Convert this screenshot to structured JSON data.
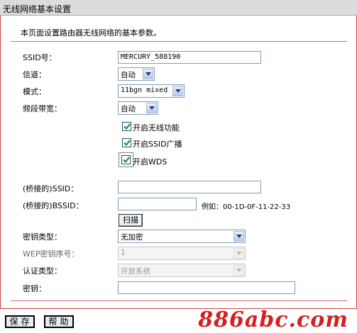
{
  "header": {
    "title": "无线网络基本设置"
  },
  "description": "本页面设置路由器无线网络的基本参数。",
  "form": {
    "ssid": {
      "label": "SSID号：",
      "value": "MERCURY_588190"
    },
    "channel": {
      "label": "信道：",
      "value": "自动"
    },
    "mode": {
      "label": "模式：",
      "value": "11bgn mixed"
    },
    "bandwidth": {
      "label": "频段带宽：",
      "value": "自动"
    },
    "enable_wireless": {
      "label": "开启无线功能",
      "checked": true
    },
    "enable_ssid_broadcast": {
      "label": "开启SSID广播",
      "checked": true
    },
    "enable_wds": {
      "label": "开启WDS",
      "checked": true
    },
    "bridge_ssid": {
      "label": "(桥接的)SSID：",
      "value": ""
    },
    "bridge_bssid": {
      "label": "(桥接的)BSSID：",
      "value": "",
      "example": "例如：00-1D-0F-11-22-33"
    },
    "scan_button": "扫描",
    "key_type": {
      "label": "密钥类型：",
      "value": "无加密"
    },
    "wep_index": {
      "label": "WEP密钥序号：",
      "value": "1"
    },
    "auth_type": {
      "label": "认证类型：",
      "value": "开放系统"
    },
    "key": {
      "label": "密钥：",
      "value": ""
    }
  },
  "footer": {
    "save_label": "保存",
    "help_label": "帮助"
  },
  "watermark": "886abc.com",
  "colors": {
    "accent_red": "#d42020",
    "checkbox_green": "#1a8a1a"
  }
}
